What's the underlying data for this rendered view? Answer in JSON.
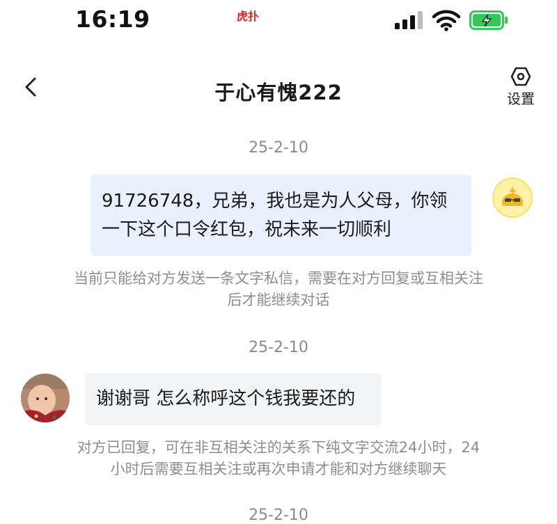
{
  "status_bar": {
    "time": "16:19",
    "badge": "虎扑",
    "signal_icon": "cellular-signal-icon",
    "wifi_icon": "wifi-icon",
    "battery_icon": "battery-charging-icon"
  },
  "header": {
    "title": "于心有愧222",
    "back_icon": "chevron-left-icon",
    "settings_icon": "hexagon-gear-icon",
    "settings_label": "设置"
  },
  "messages": [
    {
      "date": "25-2-10",
      "direction": "outgoing",
      "lines": [
        "91726748，兄弟，我也是为人父母，你领",
        "一下这个口令红包，祝未来一切顺利"
      ],
      "notice_lines": [
        "当前只能给对方发送一条文字私信，需要在对方回复或互相关注",
        "后才能继续对话"
      ]
    },
    {
      "date": "25-2-10",
      "direction": "incoming",
      "lines": [
        "谢谢哥 怎么称呼这个钱我要还的"
      ],
      "notice_lines": [
        "对方已回复，可在非互相关注的关系下纯文字交流24小时，24",
        "小时后需要互相关注或再次申请才能和对方继续聊天"
      ]
    },
    {
      "date": "25-2-10"
    }
  ],
  "colors": {
    "outgoing_bubble": "#eaf0fc",
    "incoming_bubble": "#f3f4f6",
    "battery_green": "#34c759",
    "meta_text": "#8a8a8a"
  }
}
